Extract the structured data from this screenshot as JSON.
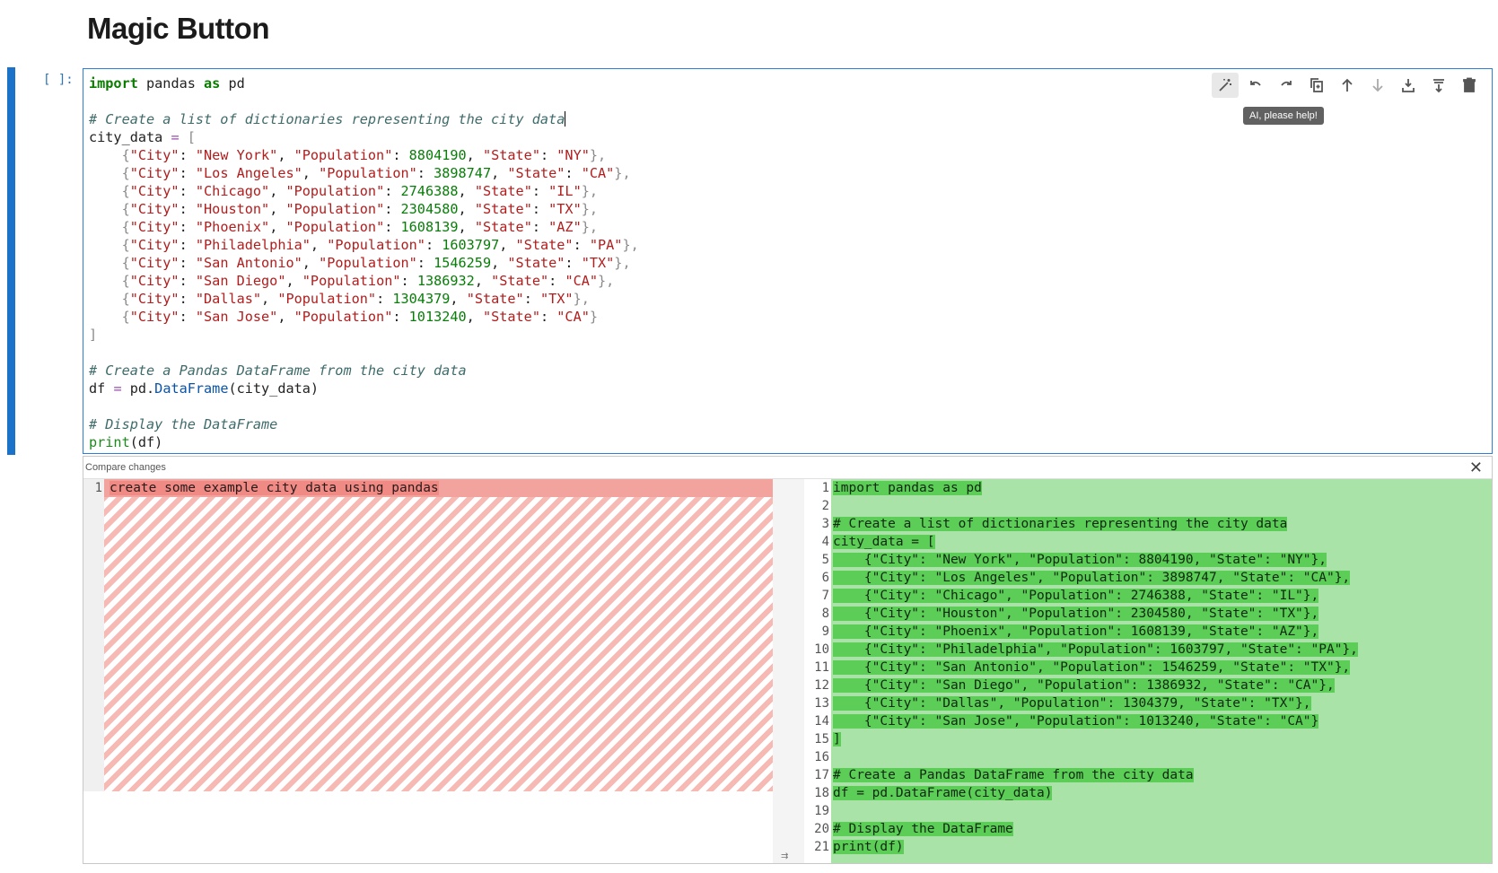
{
  "page": {
    "title": "Magic Button"
  },
  "cell": {
    "prompt": "[ ]:",
    "toolbar": [
      {
        "name": "magic-wand-icon",
        "label": "AI, please help!"
      },
      {
        "name": "undo-icon"
      },
      {
        "name": "redo-icon"
      },
      {
        "name": "copy-icon"
      },
      {
        "name": "move-up-icon"
      },
      {
        "name": "move-down-icon"
      },
      {
        "name": "insert-below-icon"
      },
      {
        "name": "insert-above-icon"
      },
      {
        "name": "delete-icon"
      }
    ],
    "tooltip": "AI, please help!"
  },
  "compare": {
    "header": "Compare changes",
    "close_glyph": "✕",
    "left": {
      "line_numbers": [
        "1"
      ],
      "lines": [
        "create some example city data using pandas"
      ]
    },
    "right": {
      "line_numbers": [
        "1",
        "2",
        "3",
        "4",
        "5",
        "6",
        "7",
        "8",
        "9",
        "10",
        "11",
        "12",
        "13",
        "14",
        "15",
        "16",
        "17",
        "18",
        "19",
        "20",
        "21"
      ],
      "lines": [
        "import pandas as pd",
        "",
        "# Create a list of dictionaries representing the city data",
        "city_data = [",
        "    {\"City\": \"New York\", \"Population\": 8804190, \"State\": \"NY\"},",
        "    {\"City\": \"Los Angeles\", \"Population\": 3898747, \"State\": \"CA\"},",
        "    {\"City\": \"Chicago\", \"Population\": 2746388, \"State\": \"IL\"},",
        "    {\"City\": \"Houston\", \"Population\": 2304580, \"State\": \"TX\"},",
        "    {\"City\": \"Phoenix\", \"Population\": 1608139, \"State\": \"AZ\"},",
        "    {\"City\": \"Philadelphia\", \"Population\": 1603797, \"State\": \"PA\"},",
        "    {\"City\": \"San Antonio\", \"Population\": 1546259, \"State\": \"TX\"},",
        "    {\"City\": \"San Diego\", \"Population\": 1386932, \"State\": \"CA\"},",
        "    {\"City\": \"Dallas\", \"Population\": 1304379, \"State\": \"TX\"},",
        "    {\"City\": \"San Jose\", \"Population\": 1013240, \"State\": \"CA\"}",
        "]",
        "",
        "# Create a Pandas DataFrame from the city data",
        "df = pd.DataFrame(city_data)",
        "",
        "# Display the DataFrame",
        "print(df)"
      ]
    }
  },
  "code": {
    "import_kw": "import",
    "pandas": " pandas ",
    "as_kw": "as",
    "pd": " pd",
    "comment1": "# Create a list of dictionaries representing the city data",
    "city_data_assign": "city_data ",
    "eq": "=",
    "open_bracket": " [",
    "rows": [
      {
        "city": "\"New York\"",
        "pop": "8804190",
        "state": "\"NY\""
      },
      {
        "city": "\"Los Angeles\"",
        "pop": "3898747",
        "state": "\"CA\""
      },
      {
        "city": "\"Chicago\"",
        "pop": "2746388",
        "state": "\"IL\""
      },
      {
        "city": "\"Houston\"",
        "pop": "2304580",
        "state": "\"TX\""
      },
      {
        "city": "\"Phoenix\"",
        "pop": "1608139",
        "state": "\"AZ\""
      },
      {
        "city": "\"Philadelphia\"",
        "pop": "1603797",
        "state": "\"PA\""
      },
      {
        "city": "\"San Antonio\"",
        "pop": "1546259",
        "state": "\"TX\""
      },
      {
        "city": "\"San Diego\"",
        "pop": "1386932",
        "state": "\"CA\""
      },
      {
        "city": "\"Dallas\"",
        "pop": "1304379",
        "state": "\"TX\""
      },
      {
        "city": "\"San Jose\"",
        "pop": "1013240",
        "state": "\"CA\""
      }
    ],
    "key_city": "\"City\"",
    "key_pop": "\"Population\"",
    "key_state": "\"State\"",
    "close_bracket": "]",
    "comment2": "# Create a Pandas DataFrame from the city data",
    "df_line_a": "df ",
    "df_line_b": " pd.",
    "dataframe_fn": "DataFrame",
    "df_line_c": "(city_data)",
    "comment3": "# Display the DataFrame",
    "print_fn": "print",
    "print_args": "(df)"
  },
  "colors": {
    "accent": "#2e7dd7",
    "removed_bg": "#f3a39e",
    "added_bg": "#aae3a7",
    "added_hl": "#5cce58"
  }
}
